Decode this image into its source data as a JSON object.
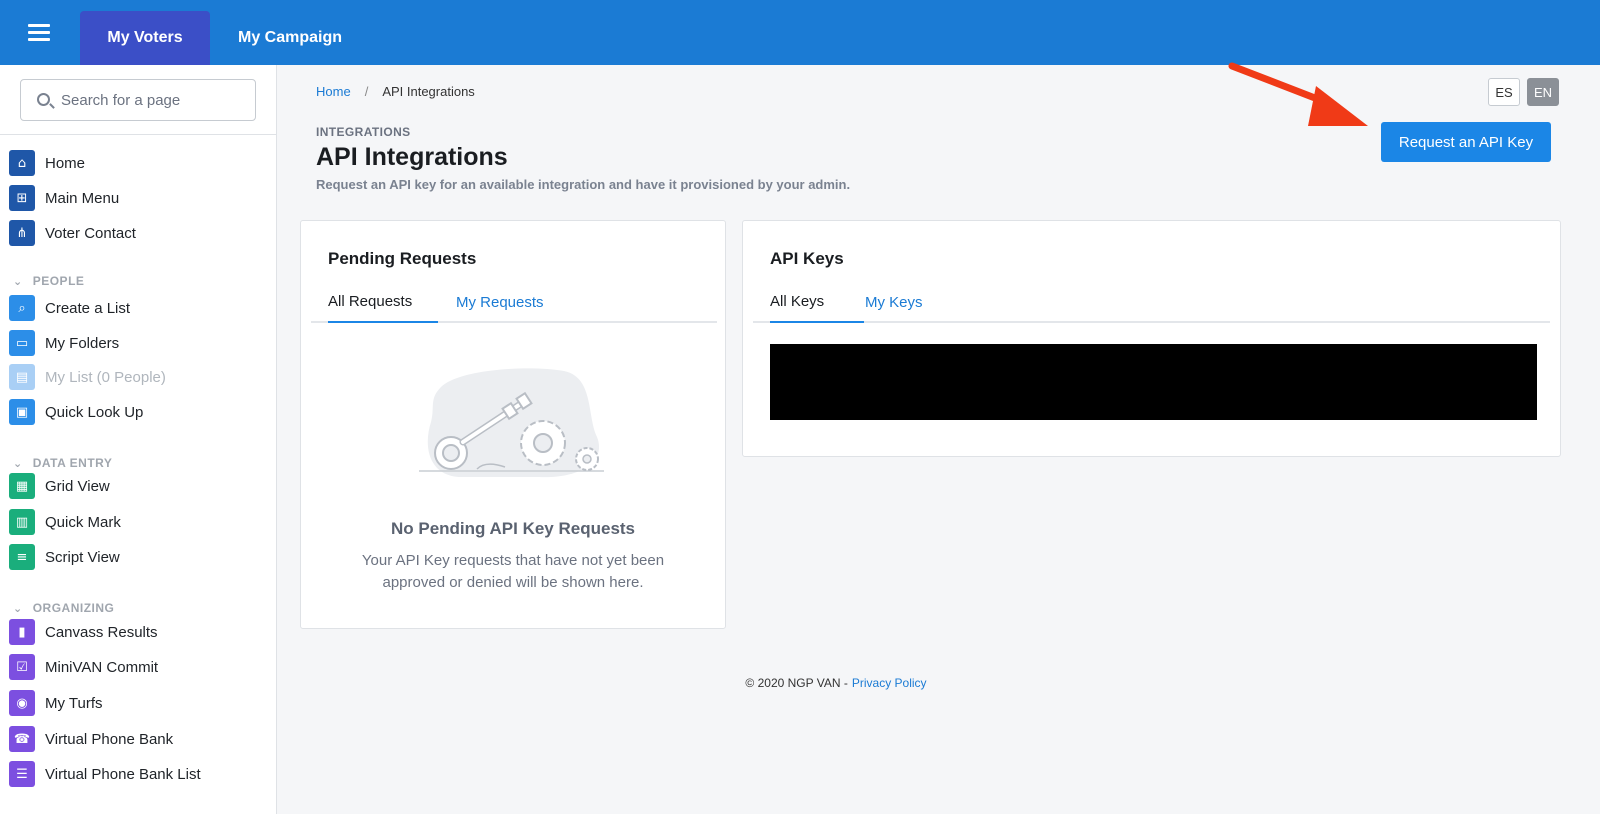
{
  "topbar": {
    "menu_icon": "hamburger-icon",
    "tabs": [
      {
        "label": "My Voters",
        "active": true
      },
      {
        "label": "My Campaign",
        "active": false
      }
    ],
    "color": "#1b7bd4",
    "active_tab_color": "#3b4fc7"
  },
  "sidebar": {
    "search_placeholder": "Search for a page",
    "top_items": [
      {
        "label": "Home",
        "icon": "home-icon"
      },
      {
        "label": "Main Menu",
        "icon": "sitemap-icon"
      },
      {
        "label": "Voter Contact",
        "icon": "org-chart-icon"
      }
    ],
    "sections": [
      {
        "title": "PEOPLE",
        "items": [
          {
            "label": "Create a List",
            "icon": "search-icon"
          },
          {
            "label": "My Folders",
            "icon": "folder-icon"
          },
          {
            "label": "My List (0 People)",
            "icon": "list-icon",
            "disabled": true
          },
          {
            "label": "Quick Look Up",
            "icon": "id-card-icon"
          }
        ]
      },
      {
        "title": "DATA ENTRY",
        "items": [
          {
            "label": "Grid View",
            "icon": "grid-icon"
          },
          {
            "label": "Quick Mark",
            "icon": "book-icon"
          },
          {
            "label": "Script View",
            "icon": "document-icon"
          }
        ]
      },
      {
        "title": "ORGANIZING",
        "items": [
          {
            "label": "Canvass Results",
            "icon": "bar-chart-icon"
          },
          {
            "label": "MiniVAN Commit",
            "icon": "checkbox-icon"
          },
          {
            "label": "My Turfs",
            "icon": "globe-icon"
          },
          {
            "label": "Virtual Phone Bank",
            "icon": "phone-icon"
          },
          {
            "label": "Virtual Phone Bank List",
            "icon": "list-icon"
          }
        ]
      }
    ]
  },
  "breadcrumb": {
    "home": "Home",
    "separator": "/",
    "current": "API Integrations"
  },
  "header": {
    "eyebrow": "INTEGRATIONS",
    "title": "API Integrations",
    "description": "Request an API key for an available integration and have it provisioned by your admin."
  },
  "language": {
    "es": "ES",
    "en": "EN",
    "selected": "EN"
  },
  "request_button": {
    "label": "Request an API Key",
    "color": "#1b86e6"
  },
  "annotation": {
    "arrow_color": "#f03a17"
  },
  "pending": {
    "title": "Pending Requests",
    "tabs": [
      "All Requests",
      "My Requests"
    ],
    "empty_title": "No Pending API Key Requests",
    "empty_text": "Your API Key requests that have not yet been approved or denied will be shown here."
  },
  "keys": {
    "title": "API Keys",
    "tabs": [
      "All Keys",
      "My Keys"
    ]
  },
  "footer": {
    "copyright": "© 2020 NGP VAN -",
    "privacy": "Privacy Policy"
  }
}
